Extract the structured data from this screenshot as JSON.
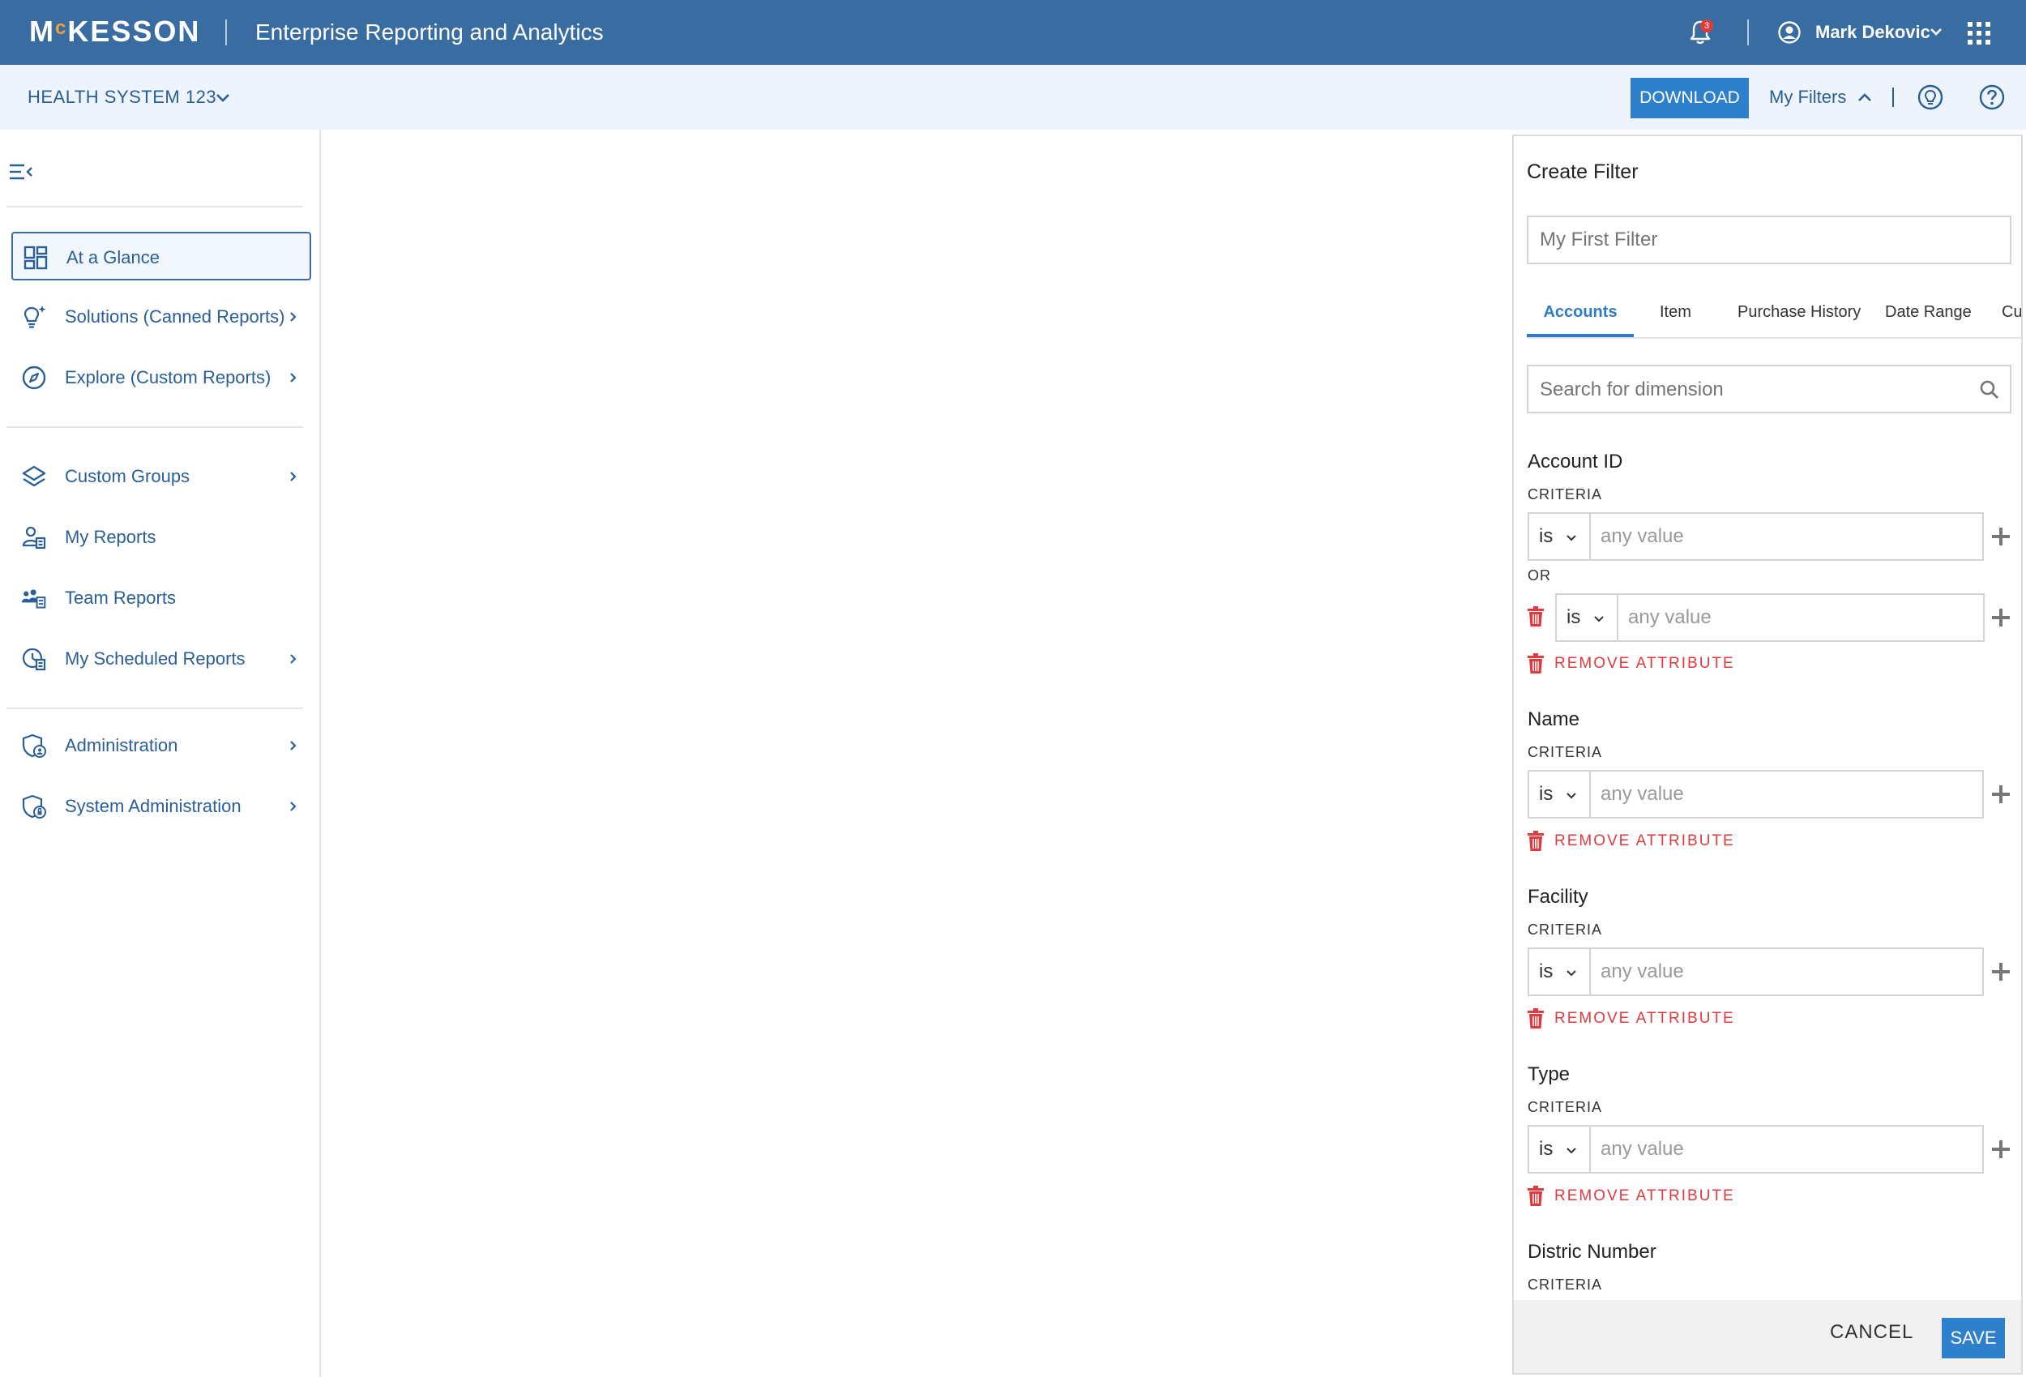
{
  "header": {
    "logo": {
      "prefix": "M",
      "small_c": "c",
      "rest": "KESSON"
    },
    "app_title": "Enterprise Reporting and Analytics",
    "notifications_count": "3",
    "user_name": "Mark Dekovic"
  },
  "subbar": {
    "organization": "HEALTH SYSTEM 123",
    "download_label": "DOWNLOAD",
    "my_filters_label": "My Filters"
  },
  "sidebar": {
    "items": [
      {
        "label": "At a Glance",
        "icon": "dashboard-icon",
        "active": true,
        "has_submenu": false
      },
      {
        "label": "Solutions (Canned Reports)",
        "icon": "lightbulb-sparkle-icon",
        "has_submenu": true
      },
      {
        "label": "Explore (Custom Reports)",
        "icon": "compass-icon",
        "has_submenu": true
      },
      {
        "label": "Custom Groups",
        "icon": "layers-icon",
        "has_submenu": true
      },
      {
        "label": "My Reports",
        "icon": "user-report-icon",
        "has_submenu": false
      },
      {
        "label": "Team Reports",
        "icon": "team-report-icon",
        "has_submenu": false
      },
      {
        "label": "My Scheduled Reports",
        "icon": "clock-report-icon",
        "has_submenu": true
      },
      {
        "label": "Administration",
        "icon": "shield-admin-icon",
        "has_submenu": true
      },
      {
        "label": "System Administration",
        "icon": "shield-system-icon",
        "has_submenu": true
      }
    ]
  },
  "filter_panel": {
    "title": "Create Filter",
    "name_placeholder": "My First Filter",
    "tabs": [
      {
        "label": "Accounts",
        "active": true
      },
      {
        "label": "Item"
      },
      {
        "label": "Purchase History"
      },
      {
        "label": "Date Range"
      },
      {
        "label": "Cu"
      }
    ],
    "search_placeholder": "Search for dimension",
    "criteria_label": "CRITERIA",
    "or_label": "OR",
    "operator": "is",
    "value_placeholder": "any value",
    "remove_label": "REMOVE ATTRIBUTE",
    "attributes": [
      {
        "name": "Account ID"
      },
      {
        "name": "Name"
      },
      {
        "name": "Facility"
      },
      {
        "name": "Type"
      },
      {
        "name": "Distric Number"
      }
    ],
    "cancel_label": "CANCEL",
    "save_label": "SAVE"
  },
  "colors": {
    "header_bg": "#396ca0",
    "subbar_bg": "#eef4fb",
    "accent": "#2f80cc",
    "nav_text": "#2a5f96",
    "danger": "#e0393e",
    "logo_accent": "#f2a03d"
  }
}
